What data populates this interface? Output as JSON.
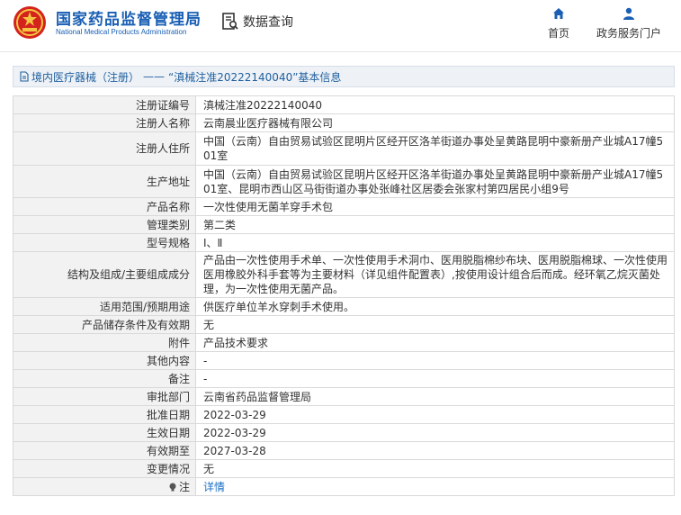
{
  "header": {
    "brand_cn": "国家药品监督管理局",
    "brand_en": "National Medical Products Administration",
    "query_label": "数据查询",
    "nav": [
      {
        "label": "首页",
        "icon": "home-icon"
      },
      {
        "label": "政务服务门户",
        "icon": "user-icon"
      }
    ]
  },
  "breadcrumb": {
    "category": "境内医疗器械（注册）",
    "separator": "——",
    "title": "“滇械注准20222140040”基本信息"
  },
  "details": {
    "rows": [
      {
        "key": "注册证编号",
        "value": "滇械注准20222140040"
      },
      {
        "key": "注册人名称",
        "value": "云南晨业医疗器械有限公司"
      },
      {
        "key": "注册人住所",
        "value": "中国（云南）自由贸易试验区昆明片区经开区洛羊街道办事处呈黄路昆明中豪新册产业城A17幢501室"
      },
      {
        "key": "生产地址",
        "value": "中国（云南）自由贸易试验区昆明片区经开区洛羊街道办事处呈黄路昆明中豪新册产业城A17幢501室、昆明市西山区马街街道办事处张峰社区居委会张家村第四居民小组9号"
      },
      {
        "key": "产品名称",
        "value": "一次性使用无菌羊穿手术包"
      },
      {
        "key": "管理类别",
        "value": "第二类"
      },
      {
        "key": "型号规格",
        "value": "Ⅰ、Ⅱ"
      },
      {
        "key": "结构及组成/主要组成成分",
        "value": "产品由一次性使用手术单、一次性使用手术洞巾、医用脱脂棉纱布块、医用脱脂棉球、一次性使用医用橡胶外科手套等为主要材料（详见组件配置表）,按使用设计组合后而成。经环氧乙烷灭菌处理，为一次性使用无菌产品。"
      },
      {
        "key": "适用范围/预期用途",
        "value": "供医疗单位羊水穿刺手术使用。"
      },
      {
        "key": "产品储存条件及有效期",
        "value": "无"
      },
      {
        "key": "附件",
        "value": "产品技术要求"
      },
      {
        "key": "其他内容",
        "value": "-"
      },
      {
        "key": "备注",
        "value": "-"
      },
      {
        "key": "审批部门",
        "value": "云南省药品监督管理局"
      },
      {
        "key": "批准日期",
        "value": "2022-03-29"
      },
      {
        "key": "生效日期",
        "value": "2022-03-29"
      },
      {
        "key": "有效期至",
        "value": "2027-03-28"
      },
      {
        "key": "变更情况",
        "value": "无"
      }
    ],
    "note_key": "注",
    "note_link": "详情"
  },
  "colors": {
    "brand_blue": "#1a5fb4",
    "label_bg": "#f2f2f2",
    "link": "#1a6fc4"
  }
}
